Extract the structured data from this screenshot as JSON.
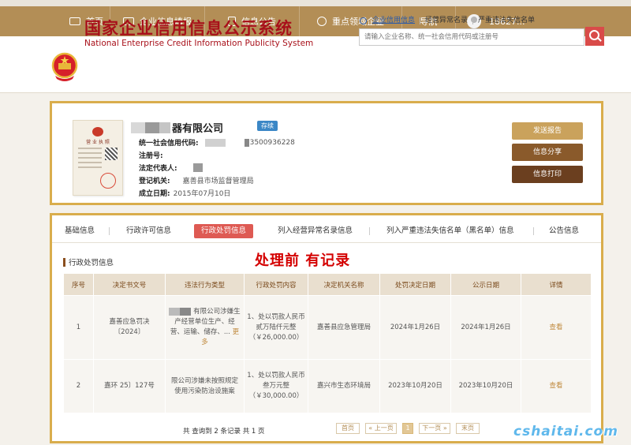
{
  "nav": {
    "items": [
      {
        "label": "首页",
        "icon": "monitor-icon"
      },
      {
        "label": "企业信息填报",
        "icon": "form-icon"
      },
      {
        "label": "信息公告",
        "icon": "document-icon"
      },
      {
        "label": "重点领域企业",
        "icon": "speaker-icon"
      },
      {
        "label": "导航",
        "icon": ""
      }
    ],
    "user_phone": "18627..."
  },
  "header": {
    "title_cn": "国家企业信用信息公示系统",
    "title_en": "National Enterprise Credit Information Publicity System",
    "search_tabs": [
      "企业信用信息",
      "经营异常名录",
      "严重违法失信名单"
    ],
    "search_placeholder": "请输入企业名称、统一社会信用代码或注册号"
  },
  "company": {
    "name_suffix": "器有限公司",
    "status": "存续",
    "license_title": "营 业 执 照",
    "fields": [
      {
        "label": "统一社会信用代码:",
        "value": "3500936228"
      },
      {
        "label": "注册号:",
        "value": ""
      },
      {
        "label": "法定代表人:",
        "value": ""
      },
      {
        "label": "登记机关:",
        "value": "嘉善县市场监督管理局"
      },
      {
        "label": "成立日期:",
        "value": "2015年07月10日"
      }
    ],
    "actions": {
      "send_report": "发送报告",
      "share": "信息分享",
      "print": "信息打印"
    }
  },
  "tabs": [
    "基础信息",
    "行政许可信息",
    "行政处罚信息",
    "列入经营异常名录信息",
    "列入严重违法失信名单（黑名单）信息",
    "公告信息"
  ],
  "section": {
    "title": "行政处罚信息",
    "annotation": "处理前 有记录"
  },
  "table": {
    "headers": [
      "序号",
      "决定书文号",
      "违法行为类型",
      "行政处罚内容",
      "决定机关名称",
      "处罚决定日期",
      "公示日期",
      "详情"
    ],
    "rows": [
      {
        "no": "1",
        "doc_no": "嘉善应急罚决〔2024〕",
        "violation": "有限公司涉嫌生产经营单位生产、经营、运输、储存、...",
        "more": "更多",
        "penalty": "1、处以罚款人民币贰万陆仟元整（￥26,000.00）",
        "authority": "嘉善县应急管理局",
        "decision_date": "2024年1月26日",
        "publish_date": "2024年1月26日",
        "detail": "查看"
      },
      {
        "no": "2",
        "doc_no": "嘉环 25〕127号",
        "violation": "限公司涉嫌未按照规定使用污染防治设施案",
        "more": "",
        "penalty": "1、处以罚款人民币叁万元整（￥30,000.00）",
        "authority": "嘉兴市生态环境局",
        "decision_date": "2023年10月20日",
        "publish_date": "2023年10月20日",
        "detail": "查看"
      }
    ]
  },
  "pagination": {
    "summary": "共 查询到 2 条记录 共 1 页",
    "first": "首页",
    "prev": "« 上一页",
    "current": "1",
    "next": "下一页 »",
    "last": "末页"
  },
  "watermark": "cshaitai.com",
  "colors": {
    "nav_bg": "#b38e56",
    "title_red": "#a8101a",
    "border_gold": "#d9ad4c",
    "active_tab": "#de5a53",
    "status_blue": "#3b87c6",
    "annotation_red": "#d40000"
  }
}
